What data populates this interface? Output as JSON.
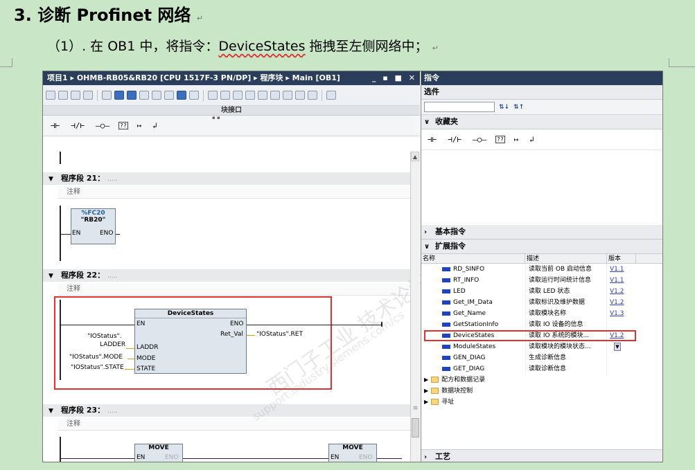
{
  "doc": {
    "heading": "3. 诊断 Profinet 网络",
    "subheading_prefix": "（1）. 在 OB1 中，将指令：",
    "subheading_term": "DeviceStates",
    "subheading_suffix": " 拖拽至左侧网络中；",
    "para_mark": "↵"
  },
  "editor": {
    "breadcrumb": "项目1 ▸ OHMB-RB05&RB20 [CPU 1517F-3 PN/DP] ▸ 程序块 ▸ Main [OB1]",
    "window_controls": "_ ▪ ■ ✕",
    "block_interface": "块接口",
    "ladder_symbols": [
      "⊣⊢",
      "⊣/⊢",
      "–○–",
      "??",
      "↦",
      "↲"
    ],
    "networks": [
      {
        "title": "程序段 21：",
        "comment": "注释",
        "dots": "....."
      },
      {
        "title": "程序段 22：",
        "comment": "注释",
        "dots": "....."
      },
      {
        "title": "程序段 23：",
        "comment": "注释",
        "dots": "....."
      }
    ],
    "fc20": {
      "number": "%FC20",
      "name": "\"RB20\"",
      "en": "EN",
      "eno": "ENO"
    },
    "devicestates": {
      "name": "DeviceStates",
      "en": "EN",
      "eno": "ENO",
      "ret_val": "Ret_Val",
      "laddr": "LADDR",
      "mode": "MODE",
      "state": "STATE",
      "laddr_tag_1": "\"IOStatus\".",
      "laddr_tag_2": "LADDER",
      "mode_tag": "\"IOStatus\".MODE",
      "state_tag": "\"IOStatus\".STATE",
      "ret_tag": "\"IOStatus\".RET"
    },
    "move": {
      "name": "MOVE",
      "en": "EN",
      "eno": "ENO"
    }
  },
  "panel": {
    "title": "指令",
    "options": "选件",
    "favorites": "收藏夹",
    "basic": "基本指令",
    "extended": "扩展指令",
    "columns": [
      "名称",
      "描述",
      "版本"
    ],
    "rows": [
      {
        "name": "RD_SINFO",
        "desc": "读取当前 OB 启动信息",
        "ver": "V1.1"
      },
      {
        "name": "RT_INFO",
        "desc": "读取运行时间统计信息",
        "ver": "V1.1"
      },
      {
        "name": "LED",
        "desc": "读取 LED 状态",
        "ver": "V1.2"
      },
      {
        "name": "Get_IM_Data",
        "desc": "读取标识及维护数据",
        "ver": "V1.2"
      },
      {
        "name": "Get_Name",
        "desc": "读取模块名称",
        "ver": "V1.3"
      },
      {
        "name": "GetStationInfo",
        "desc": "读取 IO 设备的信息",
        "ver": ""
      },
      {
        "name": "DeviceStates",
        "desc": "读取 IO 系统的模块...",
        "ver": "V1.2"
      },
      {
        "name": "ModuleStates",
        "desc": "读取模块的模块状态...",
        "ver": ""
      },
      {
        "name": "GEN_DIAG",
        "desc": "生成诊断信息",
        "ver": ""
      },
      {
        "name": "GET_DIAG",
        "desc": "读取诊断信息",
        "ver": ""
      }
    ],
    "folders": [
      "配方和数据记录",
      "数据块控制",
      "寻址"
    ],
    "technology": "工艺"
  },
  "watermark": "西门子工业 技术论坛",
  "watermark2": "support.industry.siemens.com/cs"
}
